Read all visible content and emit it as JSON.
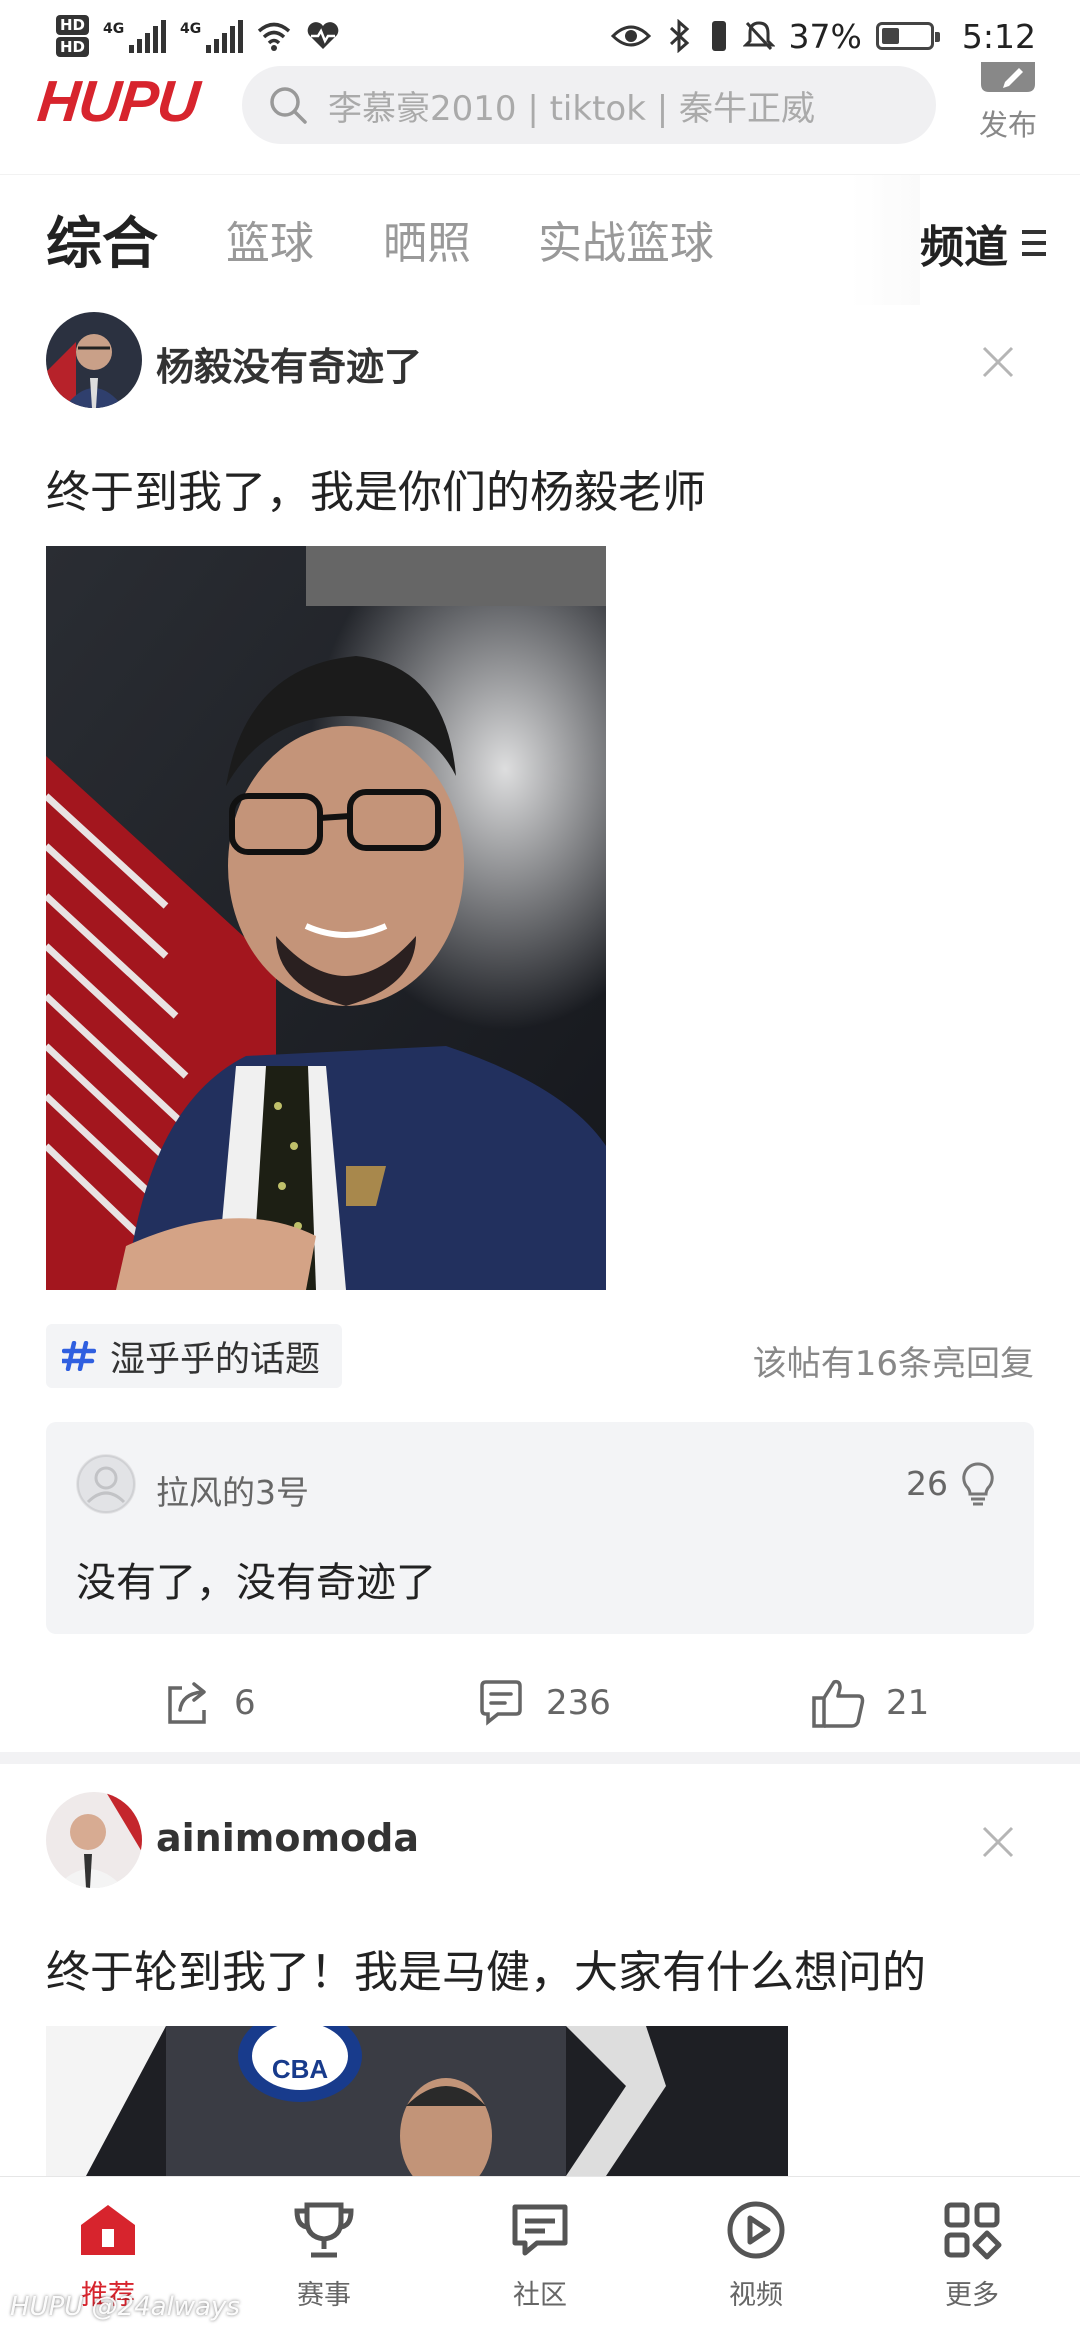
{
  "status_bar": {
    "hd1": "HD",
    "hd2": "HD",
    "net1": "4G",
    "net2": "4G",
    "battery_text": "37%",
    "battery_level": 0.37,
    "time": "5:12"
  },
  "header": {
    "logo": "HUPU",
    "search_placeholder": "李慕豪2010 | tiktok | 秦牛正威",
    "publish_label": "发布"
  },
  "tabs": {
    "items": [
      {
        "label": "综合",
        "active": true
      },
      {
        "label": "篮球",
        "active": false
      },
      {
        "label": "晒照",
        "active": false
      },
      {
        "label": "实战篮球",
        "active": false
      }
    ],
    "channel_label": "频道"
  },
  "post1": {
    "author": "杨毅没有奇迹了",
    "title": "终于到我了，我是你们的杨毅老师",
    "topic": "湿乎乎的话题",
    "reply_summary": "该帖有16条亮回复",
    "hot_reply": {
      "user": "拉风的3号",
      "likes": "26",
      "text": "没有了，没有奇迹了"
    },
    "shares": "6",
    "comments": "236",
    "likes": "21"
  },
  "post2": {
    "author": "ainimomoda",
    "title": "终于轮到我了！我是马健，大家有什么想问的",
    "image_badge": "CBA"
  },
  "bottom_nav": {
    "items": [
      {
        "label": "推荐",
        "icon": "home-icon",
        "active": true
      },
      {
        "label": "赛事",
        "icon": "trophy-icon",
        "active": false
      },
      {
        "label": "社区",
        "icon": "community-icon",
        "active": false
      },
      {
        "label": "视频",
        "icon": "video-icon",
        "active": false
      },
      {
        "label": "更多",
        "icon": "more-grid-icon",
        "active": false
      }
    ]
  },
  "watermark": "HUPU @24always",
  "colors": {
    "brand_red": "#d7242d",
    "text_dark": "#222222",
    "text_muted": "#888888",
    "card_bg": "#f3f4f6",
    "topic_blue": "#2f5fe0"
  }
}
